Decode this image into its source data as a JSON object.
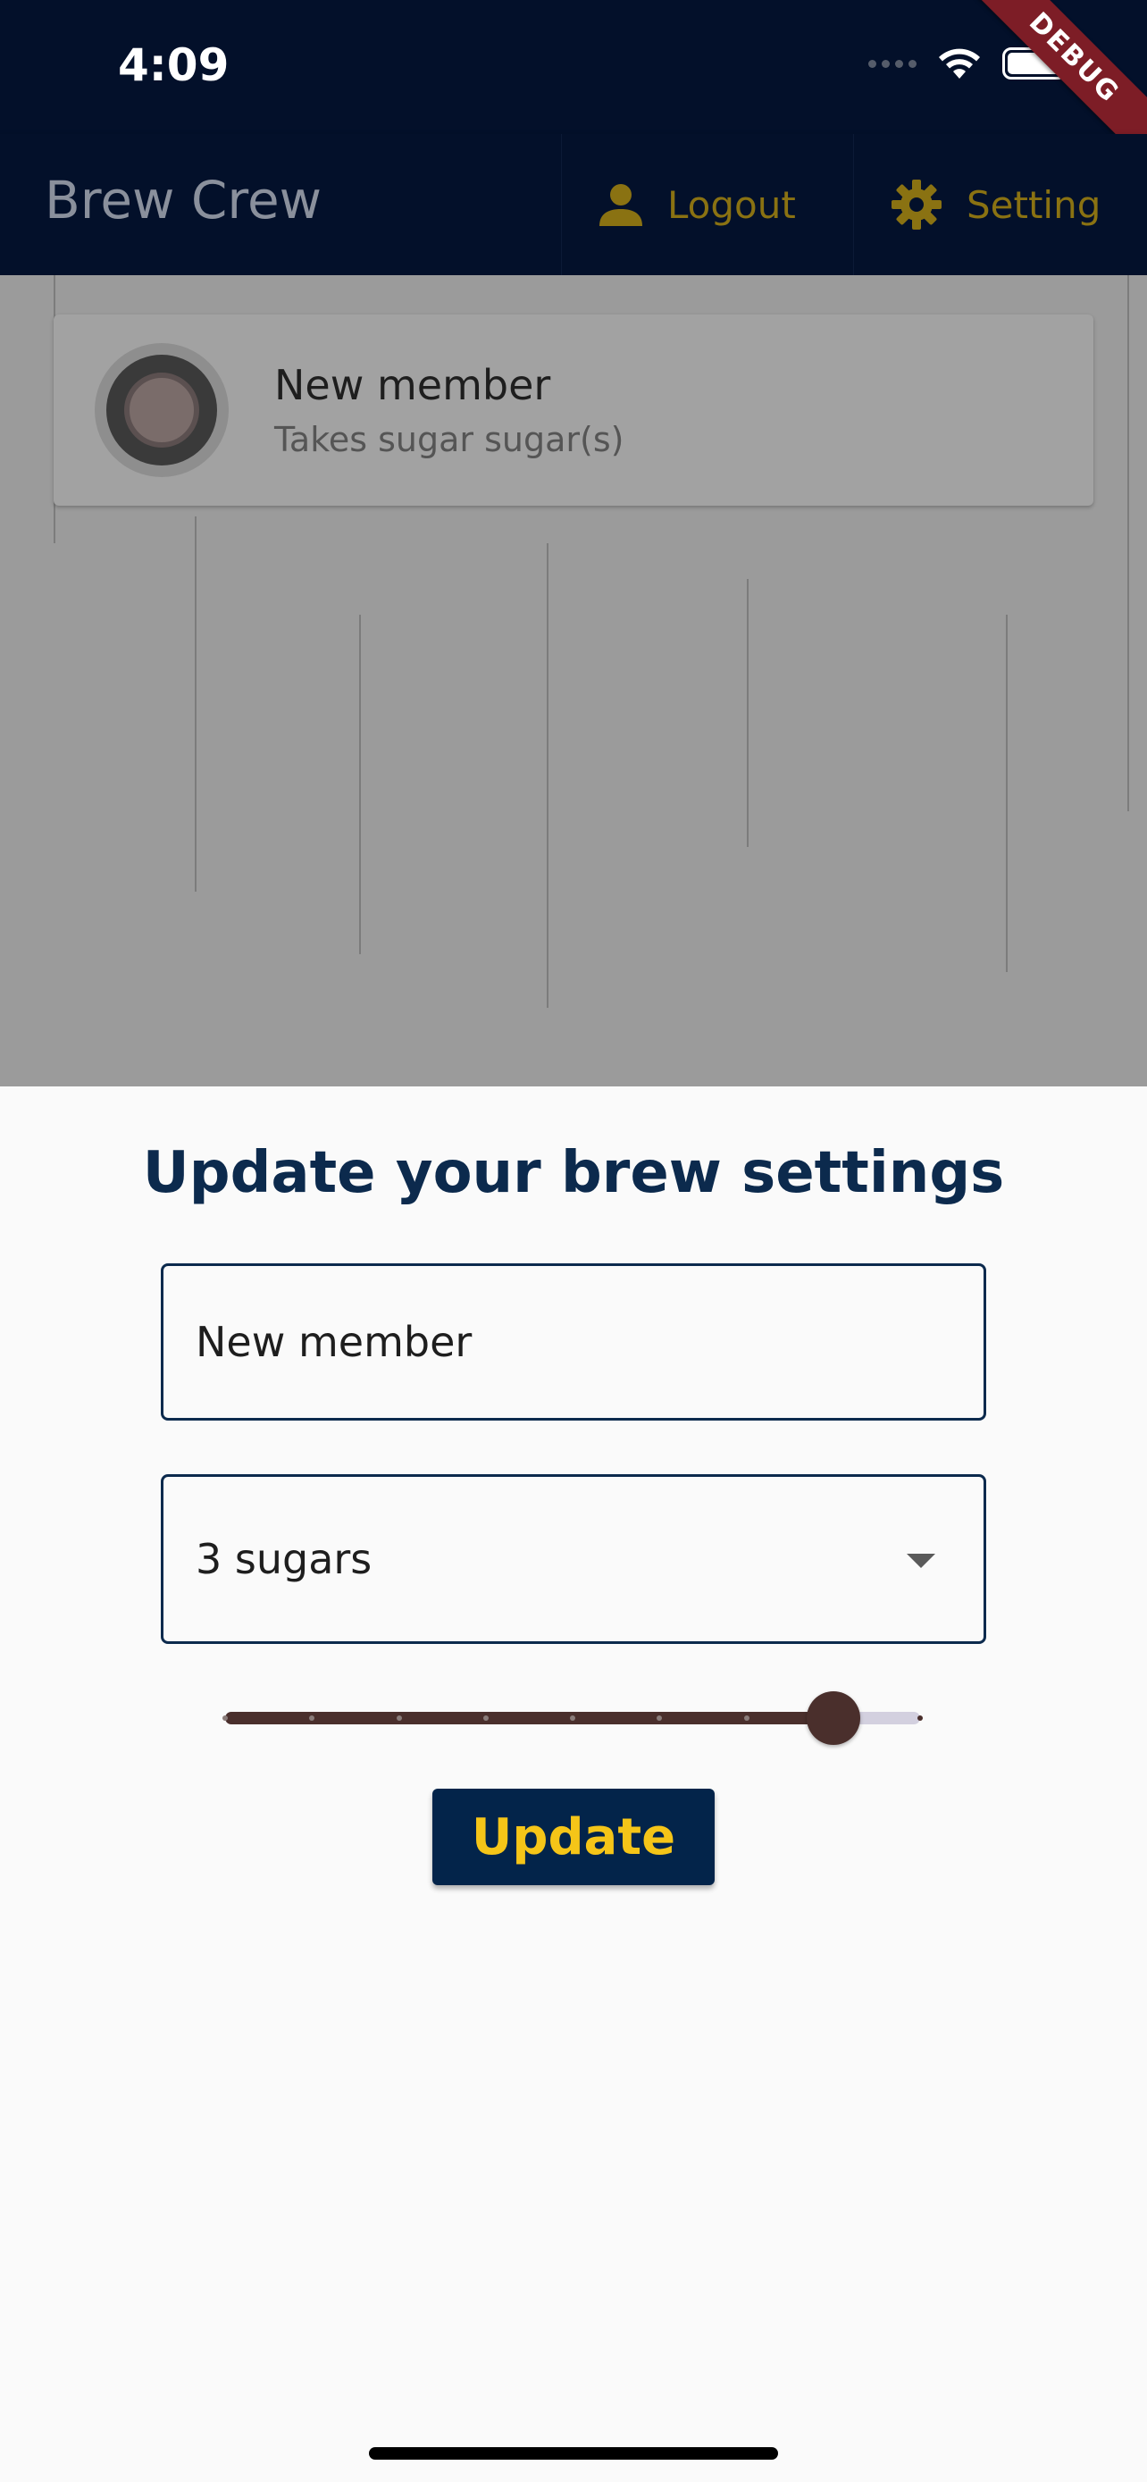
{
  "status_bar": {
    "time": "4:09",
    "debug_label": "DEBUG"
  },
  "app_bar": {
    "title": "Brew Crew",
    "logout_label": "Logout",
    "setting_label": "Setting",
    "icons": [
      "person-icon",
      "gear-icon"
    ]
  },
  "member_list": [
    {
      "name": "New member",
      "subtitle": "Takes sugar sugar(s)"
    }
  ],
  "sheet": {
    "title": "Update your brew settings",
    "name_field": {
      "value": "New member"
    },
    "sugar_dropdown": {
      "selected": "3 sugars"
    },
    "strength_slider": {
      "min": 100,
      "max": 900,
      "value": 800,
      "divisions": 8
    },
    "update_label": "Update"
  },
  "colors": {
    "navy": "#03102a",
    "accent_yellow": "#f5c518",
    "brown": "#4a2f2c"
  }
}
